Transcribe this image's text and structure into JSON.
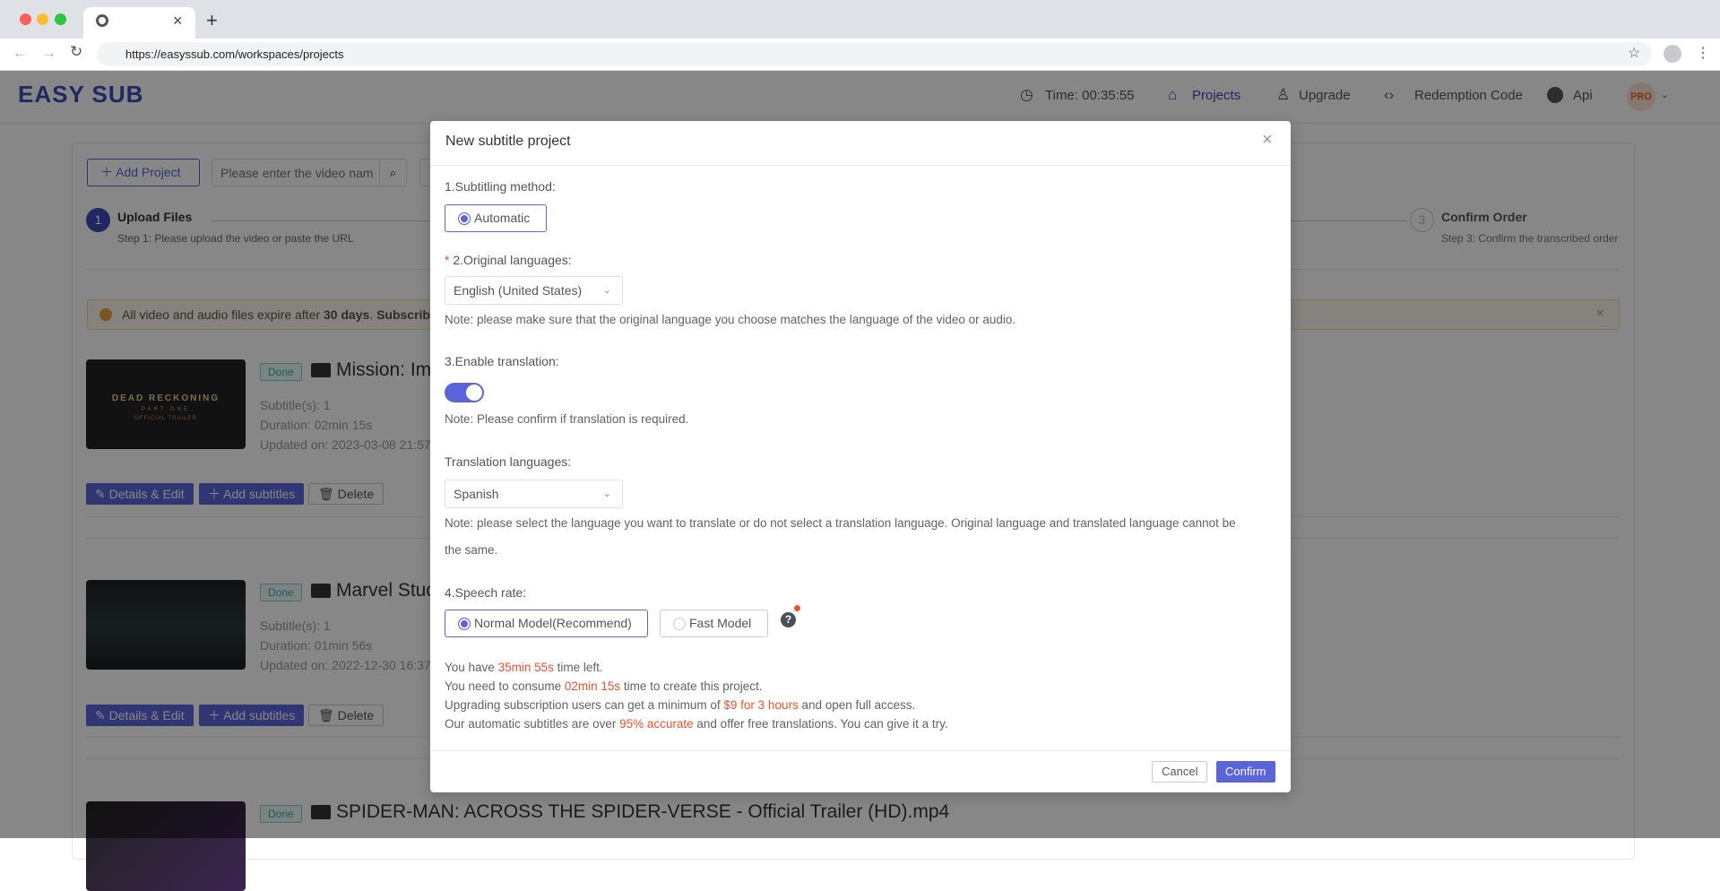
{
  "browser": {
    "url": "https://easyssub.com/workspaces/projects",
    "new_tab": "+",
    "close_tab": "×"
  },
  "header": {
    "logo": "EASY SUB",
    "time": "Time: 00:35:55",
    "nav": [
      "Projects",
      "Upgrade",
      "Redemption Code",
      "Api"
    ],
    "avatar": "PRO",
    "accent": "#5b64d9"
  },
  "toolbar": {
    "add_project": "Add Project",
    "search_placeholder": "Please enter the video nam"
  },
  "steps": [
    {
      "num": "1",
      "title": "Upload Files",
      "desc": "Step 1: Please upload the video or paste the URL"
    },
    {
      "num": "3",
      "title": "Confirm Order",
      "desc": "Step 3: Confirm the transcribed order"
    }
  ],
  "alert": {
    "pre": "All video and audio files expire after ",
    "bold": "30 days",
    "post": ". ",
    "bold2": "Subscrib"
  },
  "projects": [
    {
      "status": "Done",
      "title": "Mission: Imp",
      "subtitles": "Subtitle(s): 1",
      "duration": "Duration: 02min 15s",
      "updated": "Updated on: 2023-03-08 21:57",
      "thumb_text": [
        "DEAD RECKONING",
        "PART ONE",
        "OFFICIAL TRAILER"
      ]
    },
    {
      "status": "Done",
      "title": "Marvel Stud",
      "subtitles": "Subtitle(s): 1",
      "duration": "Duration: 01min 56s",
      "updated": "Updated on: 2022-12-30 16:37"
    },
    {
      "status": "Done",
      "title": "SPIDER-MAN: ACROSS THE SPIDER-VERSE - Official Trailer (HD).mp4"
    }
  ],
  "actions": {
    "edit": "Details & Edit",
    "add_subtitles": "Add subtitles",
    "delete": "Delete"
  },
  "modal": {
    "title": "New subtitle project",
    "method_label": "1.Subtitling method:",
    "method_option": "Automatic",
    "orig_label": "2.Original languages:",
    "required": "*",
    "orig_value": "English (United States)",
    "orig_note": "Note: please make sure that the original language you choose matches the language of the video or audio.",
    "translate_label": "3.Enable translation:",
    "translate_enabled": true,
    "translate_note": "Note: Please confirm if translation is required.",
    "trans_lang_label": "Translation languages:",
    "trans_lang_value": "Spanish",
    "trans_note1": "Note: please select the language you want to translate or do not select a translation language. Original language and translated language cannot be",
    "trans_note2": "the same.",
    "speech_label": "4.Speech rate:",
    "speech_normal": "Normal Model(Recommend)",
    "speech_fast": "Fast Model",
    "help": "?",
    "info": [
      {
        "a": "You have ",
        "h": "35min 55s",
        "b": " time left."
      },
      {
        "a": "You need to consume ",
        "h": "02min 15s",
        "b": " time to create this project."
      },
      {
        "a": "Upgrading subscription users can get a minimum of ",
        "h": "$9 for 3 hours",
        "b": " and open full access."
      },
      {
        "a": "Our automatic subtitles are over ",
        "h": "95% accurate",
        "b": " and offer free translations. You can give it a try."
      }
    ],
    "cancel": "Cancel",
    "confirm": "Confirm",
    "highlight_color": "#f0502c"
  }
}
